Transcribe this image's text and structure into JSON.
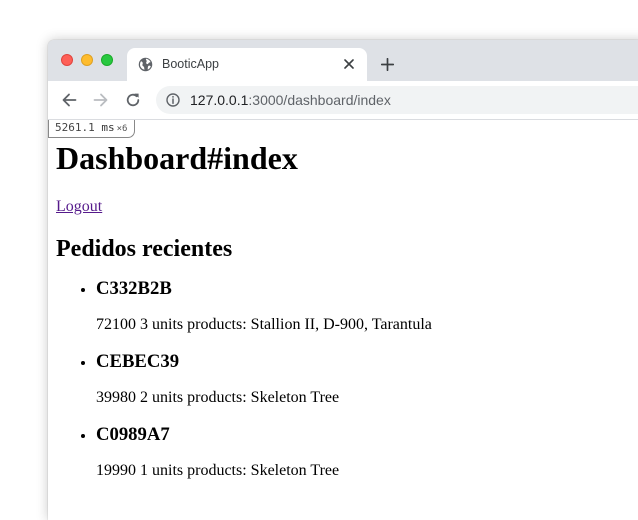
{
  "browser": {
    "tab_title": "BooticApp",
    "url_host": "127.0.0.1",
    "url_rest": ":3000/dashboard/index"
  },
  "profiler": {
    "time": "5261.1",
    "unit": "ms",
    "count": "×6"
  },
  "page": {
    "title": "Dashboard#index",
    "logout_label": "Logout",
    "orders_heading": "Pedidos recientes",
    "orders": [
      {
        "code": "C332B2B",
        "details": "72100 3 units products: Stallion II, D-900, Tarantula"
      },
      {
        "code": "CEBEC39",
        "details": "39980 2 units products: Skeleton Tree"
      },
      {
        "code": "C0989A7",
        "details": "19990 1 units products: Skeleton Tree"
      }
    ]
  },
  "colors": {
    "tabbar_bg": "#dee1e6",
    "visited_link": "#551a8b",
    "traffic_red": "#fe5f57",
    "traffic_yellow": "#febc2e",
    "traffic_green": "#28c840"
  },
  "icons": [
    "globe-icon",
    "close-icon",
    "plus-icon",
    "back-arrow-icon",
    "forward-arrow-icon",
    "reload-icon",
    "info-icon"
  ]
}
